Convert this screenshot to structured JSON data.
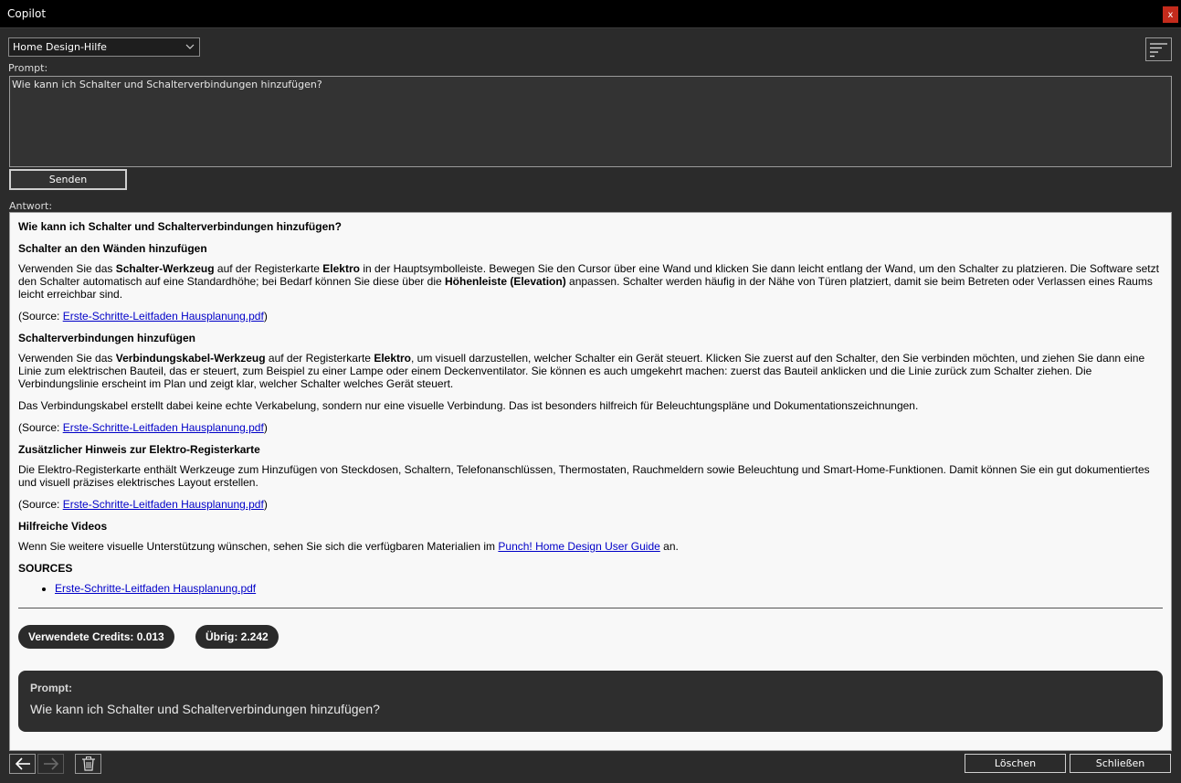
{
  "window": {
    "title": "Copilot",
    "close_label": "x"
  },
  "mode_select": {
    "value": "Home Design-Hilfe"
  },
  "prompt": {
    "label": "Prompt:",
    "value": "Wie kann ich Schalter und Schalterverbindungen hinzufügen?"
  },
  "send_label": "Senden",
  "answer": {
    "label": "Antwort:",
    "heading": "Wie kann ich Schalter und Schalterverbindungen hinzufügen?",
    "s1": {
      "title": "Schalter an den Wänden hinzufügen",
      "t1": "Verwenden Sie das ",
      "b1": "Schalter-Werkzeug",
      "t2": " auf der Registerkarte ",
      "b2": "Elektro",
      "t3": " in der Hauptsymbolleiste. Bewegen Sie den Cursor über eine Wand und klicken Sie dann leicht entlang der Wand, um den Schalter zu platzieren. Die Software setzt den Schalter automatisch auf eine Standardhöhe; bei Bedarf können Sie diese über die ",
      "b3": "Höhenleiste (Elevation)",
      "t4": " anpassen. Schalter werden häufig in der Nähe von Türen platziert, damit sie beim Betreten oder Verlassen eines Raums leicht erreichbar sind.",
      "src_prefix": "(Source: ",
      "src_link": "Erste-Schritte-Leitfaden Hausplanung.pdf",
      "src_suffix": ")"
    },
    "s2": {
      "title": "Schalterverbindungen hinzufügen",
      "t1": "Verwenden Sie das ",
      "b1": "Verbindungskabel-Werkzeug",
      "t2": " auf der Registerkarte ",
      "b2": "Elektro",
      "t3": ", um visuell darzustellen, welcher Schalter ein Gerät steuert. Klicken Sie zuerst auf den Schalter, den Sie verbinden möchten, und ziehen Sie dann eine Linie zum elektrischen Bauteil, das er steuert, zum Beispiel zu einer Lampe oder einem Deckenventilator. Sie können es auch umgekehrt machen: zuerst das Bauteil anklicken und die Linie zurück zum Schalter ziehen. Die Verbindungslinie erscheint im Plan und zeigt klar, welcher Schalter welches Gerät steuert.",
      "p2": "Das Verbindungskabel erstellt dabei keine echte Verkabelung, sondern nur eine visuelle Verbindung. Das ist besonders hilfreich für Beleuchtungspläne und Dokumentationszeichnungen.",
      "src_prefix": "(Source: ",
      "src_link": "Erste-Schritte-Leitfaden Hausplanung.pdf",
      "src_suffix": ")"
    },
    "s3": {
      "title": "Zusätzlicher Hinweis zur Elektro-Registerkarte",
      "p1": "Die Elektro-Registerkarte enthält Werkzeuge zum Hinzufügen von Steckdosen, Schaltern, Telefonanschlüssen, Thermostaten, Rauchmeldern sowie Beleuchtung und Smart-Home-Funktionen. Damit können Sie ein gut dokumentiertes und visuell präzises elektrisches Layout erstellen.",
      "src_prefix": "(Source: ",
      "src_link": "Erste-Schritte-Leitfaden Hausplanung.pdf",
      "src_suffix": ")"
    },
    "s4": {
      "title": "Hilfreiche Videos",
      "t1": "Wenn Sie weitere visuelle Unterstützung wünschen, sehen Sie sich die verfügbaren Materialien im ",
      "link": "Punch! Home Design User Guide",
      "t2": " an."
    },
    "sources": {
      "title": "SOURCES",
      "items": [
        "Erste-Schritte-Leitfaden Hausplanung.pdf"
      ]
    },
    "credits_used": "Verwendete Credits: 0.013",
    "credits_left": "Übrig: 2.242",
    "echo_label": "Prompt:",
    "echo_text": "Wie kann ich Schalter und Schalterverbindungen hinzufügen?"
  },
  "footer": {
    "delete_label": "Löschen",
    "close_label": "Schließen"
  },
  "icons": {
    "back": "arrow-left-icon",
    "forward": "arrow-right-icon",
    "trash": "trash-icon",
    "menu": "sort-lines-icon",
    "chevron": "chevron-down-icon"
  }
}
